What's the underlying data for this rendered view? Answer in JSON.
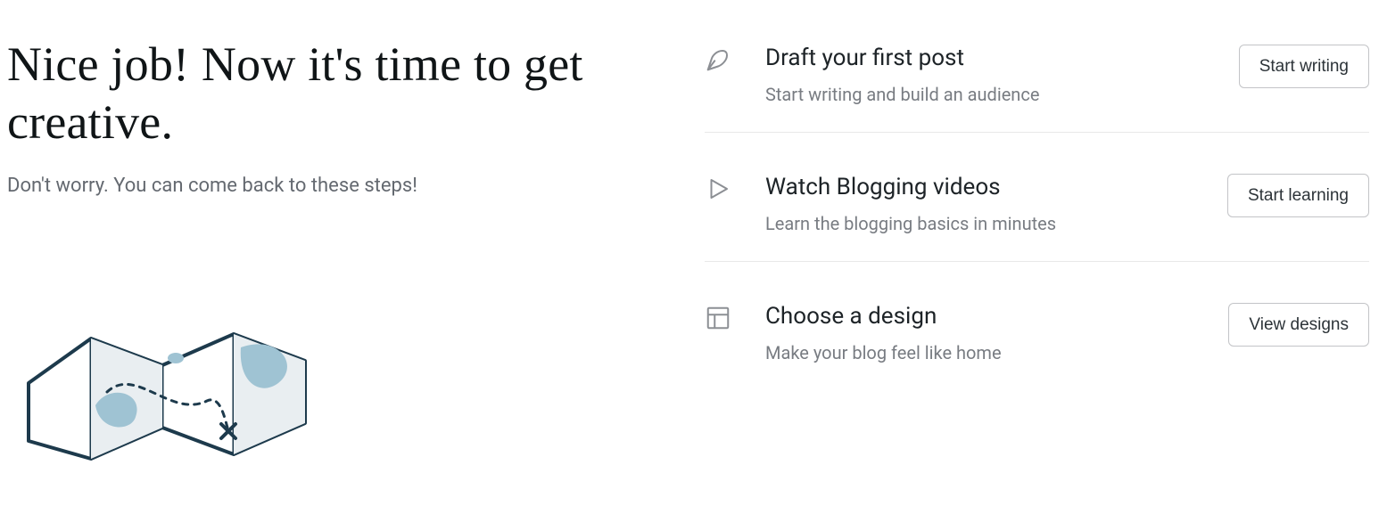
{
  "left": {
    "headline": "Nice job! Now it's time to get creative.",
    "subtext": "Don't worry. You can come back to these steps!"
  },
  "steps": [
    {
      "icon": "pen",
      "title": "Draft your first post",
      "desc": "Start writing and build an audience",
      "button": "Start writing"
    },
    {
      "icon": "play",
      "title": "Watch Blogging videos",
      "desc": "Learn the blogging basics in minutes",
      "button": "Start learning"
    },
    {
      "icon": "layout",
      "title": "Choose a design",
      "desc": "Make your blog feel like home",
      "button": "View designs"
    }
  ]
}
